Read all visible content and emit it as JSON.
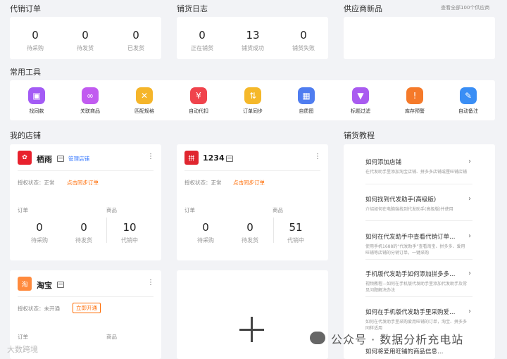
{
  "consign_orders": {
    "title": "代销订单",
    "stats": [
      {
        "value": "0",
        "label": "待采购"
      },
      {
        "value": "0",
        "label": "待发货"
      },
      {
        "value": "0",
        "label": "已发货"
      }
    ]
  },
  "distribution_log": {
    "title": "铺货日志",
    "stats": [
      {
        "value": "0",
        "label": "正在铺货"
      },
      {
        "value": "13",
        "label": "铺货成功"
      },
      {
        "value": "0",
        "label": "铺货失败"
      }
    ]
  },
  "supplier_new": {
    "title": "供应商新品",
    "view_all": "查看全部100个供应商"
  },
  "tools": {
    "title": "常用工具",
    "items": [
      {
        "label": "找同款",
        "icon": "find-same-icon",
        "color": "#a35bf5"
      },
      {
        "label": "关联商品",
        "icon": "link-product-icon",
        "color": "#c15bf0"
      },
      {
        "label": "匹配规格",
        "icon": "match-spec-icon",
        "color": "#f5b52a"
      },
      {
        "label": "自动代扣",
        "icon": "auto-deduct-icon",
        "color": "#f0434c"
      },
      {
        "label": "订单同步",
        "icon": "order-sync-icon",
        "color": "#f5b82a"
      },
      {
        "label": "自质图",
        "icon": "image-icon",
        "color": "#4f7df0"
      },
      {
        "label": "标题过滤",
        "icon": "filter-icon",
        "color": "#a95bf0"
      },
      {
        "label": "库存预警",
        "icon": "stock-alert-icon",
        "color": "#f57a2a"
      },
      {
        "label": "自动备注",
        "icon": "auto-note-icon",
        "color": "#3a8ef5"
      }
    ]
  },
  "my_shops": {
    "title": "我的店铺",
    "shops": [
      {
        "name": "栖雨",
        "manage": "管理店铺",
        "auth_label": "授权状态：正常",
        "sync_label": "点击同步订单",
        "orders_label": "订单",
        "goods_label": "商品",
        "stats": [
          {
            "value": "0",
            "label": "待采购"
          },
          {
            "value": "0",
            "label": "待发货"
          },
          {
            "value": "10",
            "label": "代销中"
          }
        ],
        "logo_color": "#e8212d",
        "logo_text": "✿"
      },
      {
        "name": "1234",
        "auth_label": "授权状态：正常",
        "sync_label": "点击同步订单",
        "orders_label": "订单",
        "goods_label": "商品",
        "stats": [
          {
            "value": "0",
            "label": "待采购"
          },
          {
            "value": "0",
            "label": "待发货"
          },
          {
            "value": "51",
            "label": "代销中"
          }
        ],
        "logo_color": "#e0262f",
        "logo_text": "拼"
      },
      {
        "name": "淘宝",
        "auth_label": "授权状态：未开通",
        "open_label": "立即开通",
        "orders_label": "订单",
        "goods_label": "商品",
        "logo_color": "#ff8a3d",
        "logo_text": "淘"
      }
    ]
  },
  "tutorial": {
    "title": "铺货教程",
    "items": [
      {
        "title": "如何添加店铺",
        "desc": "在代发助手里添加淘宝店铺、拼多多店铺或厘旺铺店铺"
      },
      {
        "title": "如何找到代发助手(高级版)",
        "desc": "介绍如何在电脑端找到代发助手(高级版)并使用"
      },
      {
        "title": "如何在代发助手中查看代销订单…",
        "desc": "使用手机1688的“代发助手”查看淘宝、拼多多、爱用旺铺等店铺的分销订单，一键采购"
      },
      {
        "title": "手机版代发助手如何添加拼多多…",
        "desc": "视频教程—如何在手机版代发助手里添加代发助手及常见问题解决办法"
      },
      {
        "title": "如何在手机版代发助手里采购爱…",
        "desc": "如何在代发助手里采购爱用旺铺的订单，淘宝、拼多多同样适用"
      },
      {
        "title": "如何将爱用旺铺的商品信息…",
        "desc": ""
      }
    ]
  },
  "watermark": {
    "text": "公众号 · 数据分析充电站",
    "left": "大数跨境"
  }
}
